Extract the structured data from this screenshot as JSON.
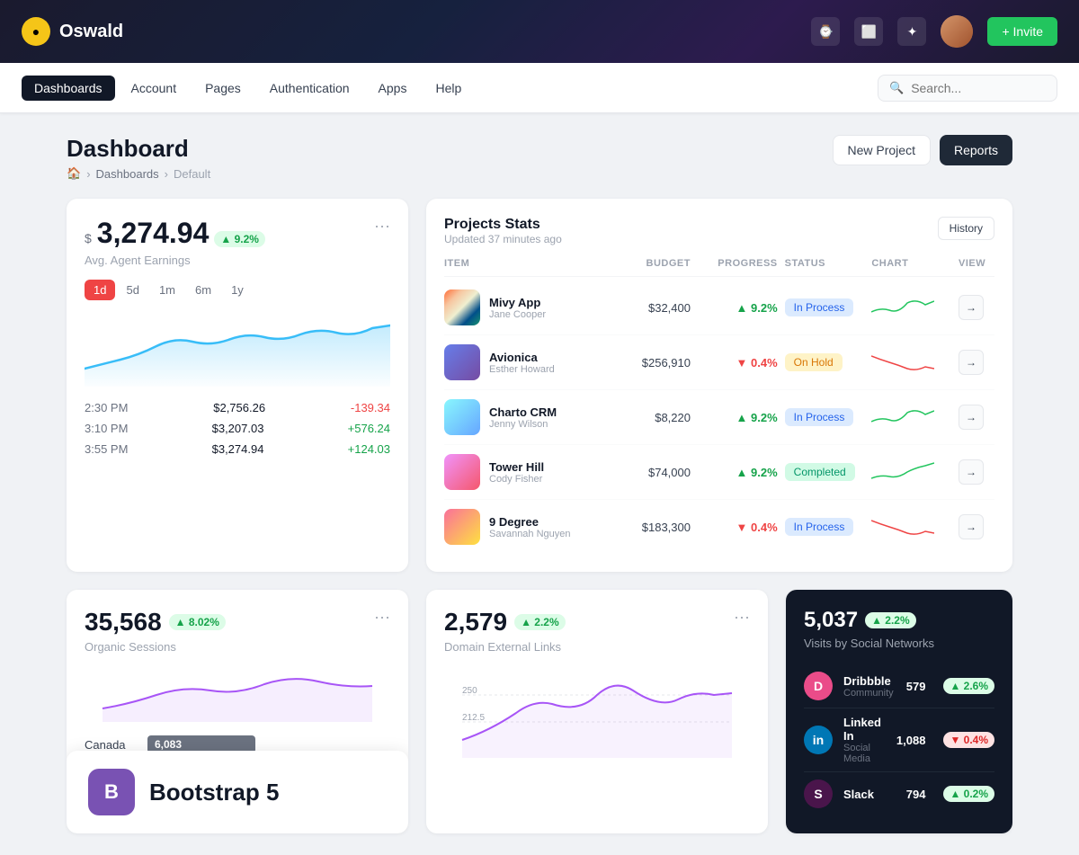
{
  "topbar": {
    "logo_text": "Oswald",
    "invite_label": "+ Invite"
  },
  "navbar": {
    "items": [
      {
        "label": "Dashboards",
        "active": true
      },
      {
        "label": "Account",
        "active": false
      },
      {
        "label": "Pages",
        "active": false
      },
      {
        "label": "Authentication",
        "active": false
      },
      {
        "label": "Apps",
        "active": false
      },
      {
        "label": "Help",
        "active": false
      }
    ],
    "search_placeholder": "Search..."
  },
  "page": {
    "title": "Dashboard",
    "breadcrumb": [
      "Home",
      "Dashboards",
      "Default"
    ],
    "btn_new": "New Project",
    "btn_reports": "Reports"
  },
  "earnings": {
    "currency": "$",
    "amount": "3,274.94",
    "badge": "▲ 9.2%",
    "subtitle": "Avg. Agent Earnings",
    "time_filters": [
      "1d",
      "5d",
      "1m",
      "6m",
      "1y"
    ],
    "active_filter": "1d",
    "rows": [
      {
        "time": "2:30 PM",
        "value": "$2,756.26",
        "change": "-139.34",
        "type": "neg"
      },
      {
        "time": "3:10 PM",
        "value": "$3,207.03",
        "change": "+576.24",
        "type": "pos"
      },
      {
        "time": "3:55 PM",
        "value": "$3,274.94",
        "change": "+124.03",
        "type": "pos"
      }
    ]
  },
  "projects": {
    "title": "Projects Stats",
    "updated": "Updated 37 minutes ago",
    "btn_history": "History",
    "columns": [
      "ITEM",
      "BUDGET",
      "PROGRESS",
      "STATUS",
      "CHART",
      "VIEW"
    ],
    "rows": [
      {
        "name": "Mivy App",
        "author": "Jane Cooper",
        "budget": "$32,400",
        "progress": "▲ 9.2%",
        "progress_type": "pos",
        "status": "In Process",
        "status_type": "inprocess",
        "thumb": "1"
      },
      {
        "name": "Avionica",
        "author": "Esther Howard",
        "budget": "$256,910",
        "progress": "▼ 0.4%",
        "progress_type": "neg",
        "status": "On Hold",
        "status_type": "onhold",
        "thumb": "2"
      },
      {
        "name": "Charto CRM",
        "author": "Jenny Wilson",
        "budget": "$8,220",
        "progress": "▲ 9.2%",
        "progress_type": "pos",
        "status": "In Process",
        "status_type": "inprocess",
        "thumb": "3"
      },
      {
        "name": "Tower Hill",
        "author": "Cody Fisher",
        "budget": "$74,000",
        "progress": "▲ 9.2%",
        "progress_type": "pos",
        "status": "Completed",
        "status_type": "completed",
        "thumb": "4"
      },
      {
        "name": "9 Degree",
        "author": "Savannah Nguyen",
        "budget": "$183,300",
        "progress": "▼ 0.4%",
        "progress_type": "neg",
        "status": "In Process",
        "status_type": "inprocess",
        "thumb": "5"
      }
    ]
  },
  "organic": {
    "amount": "35,568",
    "badge": "▲ 8.02%",
    "subtitle": "Organic Sessions",
    "geo_label": "Canada",
    "geo_value": "6,083"
  },
  "domain": {
    "amount": "2,579",
    "badge": "▲ 2.2%",
    "subtitle": "Domain External Links"
  },
  "social": {
    "amount": "5,037",
    "badge": "▲ 2.2%",
    "subtitle": "Visits by Social Networks",
    "networks": [
      {
        "name": "Dribbble",
        "type": "Community",
        "count": "579",
        "badge": "▲ 2.6%",
        "badge_type": "pos",
        "icon": "D"
      },
      {
        "name": "Linked In",
        "type": "Social Media",
        "count": "1,088",
        "badge": "▼ 0.4%",
        "badge_type": "neg",
        "icon": "in"
      },
      {
        "name": "Slack",
        "type": "",
        "count": "794",
        "badge": "▲ 0.2%",
        "badge_type": "pos",
        "icon": "S"
      }
    ]
  },
  "bootstrap": {
    "icon": "B",
    "text": "Bootstrap 5"
  }
}
